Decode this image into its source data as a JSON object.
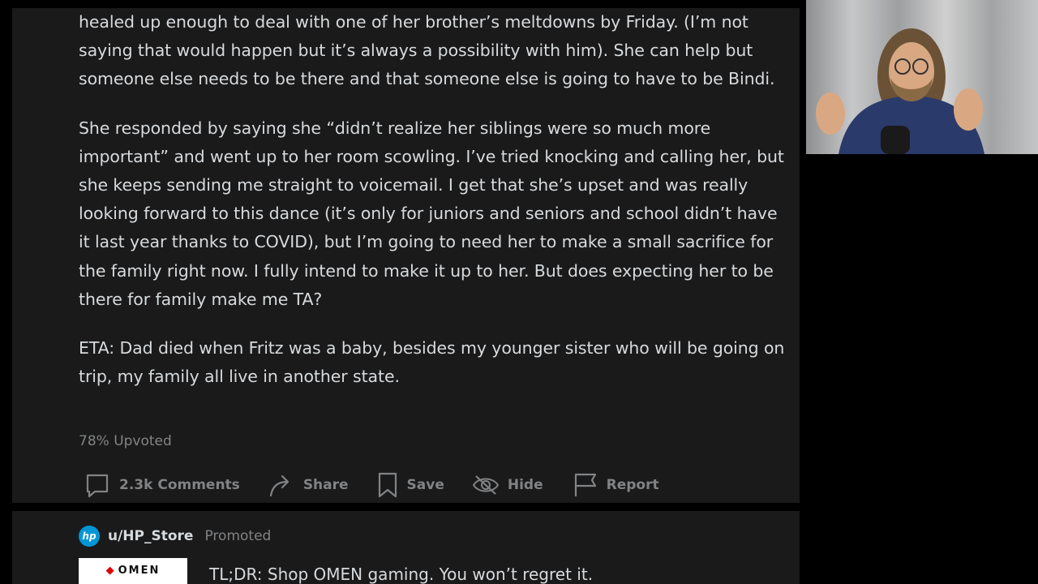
{
  "post": {
    "paragraphs": [
      "healed up enough to deal with one of her brother’s meltdowns by Friday. (I’m not saying that would happen but it’s always a possibility with him). She can help but someone else needs to be there and that someone else is going to have to be Bindi.",
      "She responded by saying she “didn’t realize her siblings were so much more important” and went up to her room scowling. I’ve tried knocking and calling her, but she keeps sending me straight to voicemail. I get that she’s upset and was really looking forward to this dance (it’s only for juniors and seniors and school didn’t have it last year thanks to COVID), but I’m going to need her to make a small sacrifice for the family right now. I fully intend to make it up to her. But does expecting her to be there for family make me TA?",
      "ETA: Dad died when Fritz was a baby, besides my younger sister who will be going on trip, my family all live in another state."
    ],
    "upvote_text": "78% Upvoted",
    "actions": {
      "comments": "2.3k Comments",
      "share": "Share",
      "save": "Save",
      "hide": "Hide",
      "report": "Report"
    }
  },
  "promo": {
    "user": "u/HP_Store",
    "tag": "Promoted",
    "logo_text": "hp",
    "banner_text": "OMEN",
    "headline": "TL;DR: Shop OMEN gaming. You won’t regret it."
  },
  "colors": {
    "background": "#000000",
    "card": "#1a1a1b",
    "text": "#d7dadc",
    "muted": "#818384",
    "hp_blue": "#0096d6"
  }
}
